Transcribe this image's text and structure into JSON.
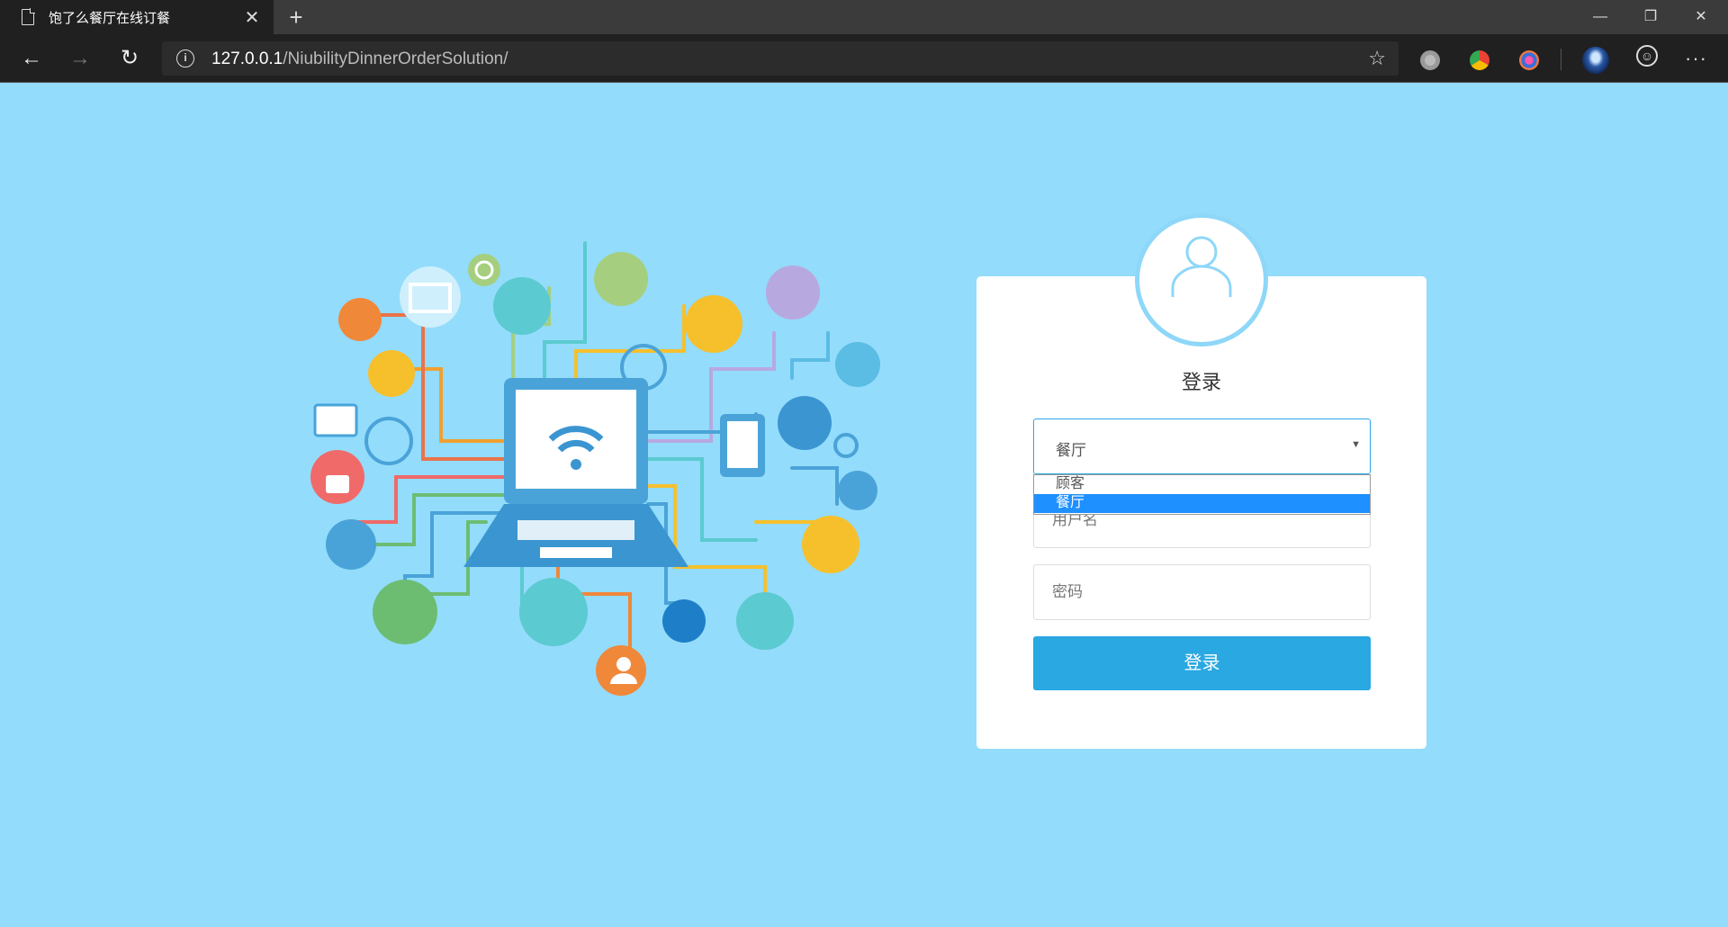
{
  "browser": {
    "tab_title": "饱了么餐厅在线订餐",
    "tab_close": "✕",
    "new_tab": "+",
    "url_host": "127.0.0.1",
    "url_path": "/NiubilityDinnerOrderSolution/",
    "info_glyph": "i",
    "star_glyph": "☆",
    "more_glyph": "···",
    "minimize_glyph": "—",
    "restore_glyph": "❐",
    "close_glyph": "✕",
    "back_glyph": "←",
    "forward_glyph": "→",
    "refresh_glyph": "↻"
  },
  "login": {
    "title": "登录",
    "role_select_value": "餐厅",
    "role_options": [
      "顾客",
      "餐厅"
    ],
    "selected_option": "餐厅",
    "username_placeholder": "用户名",
    "password_placeholder": "密码",
    "submit_label": "登录"
  },
  "colors": {
    "page_background": "#93dcfb",
    "button": "#29a8e2",
    "selected_option": "#1e90ff"
  }
}
